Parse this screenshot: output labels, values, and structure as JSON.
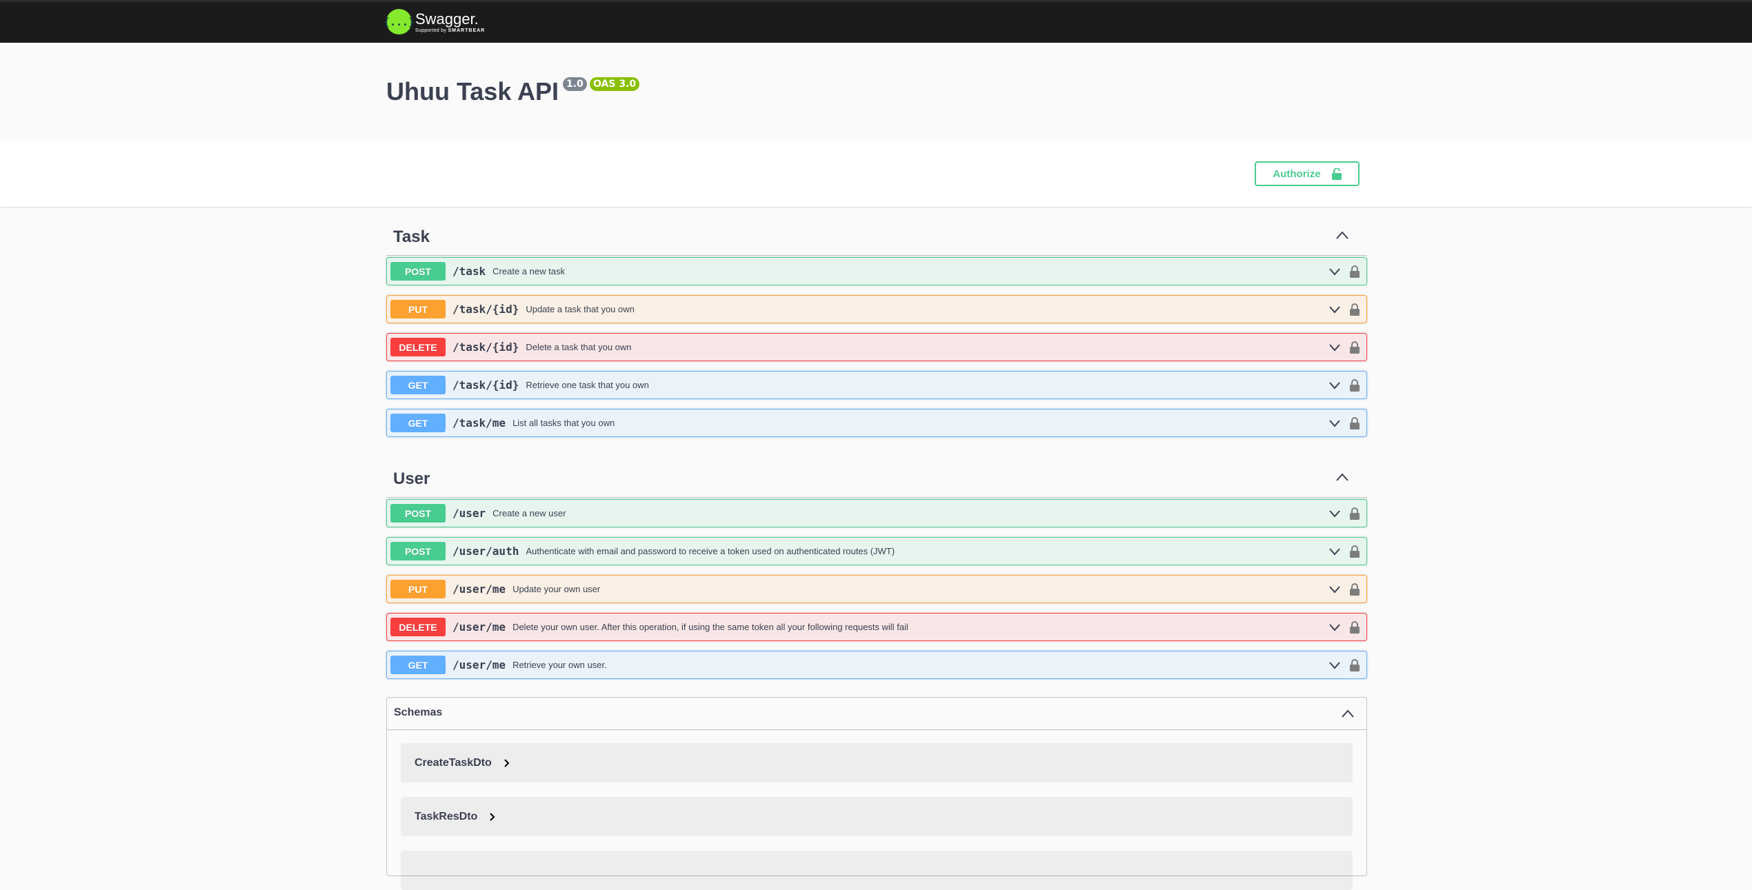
{
  "topbar": {
    "logo_mark": "{...}",
    "logo_name": "Swagger.",
    "logo_sub_prefix": "Supported by",
    "logo_sub_brand": "SMARTBEAR"
  },
  "info": {
    "title": "Uhuu Task API",
    "version": "1.0",
    "oas": "OAS 3.0"
  },
  "scheme": {
    "authorize_label": "Authorize"
  },
  "sections": [
    {
      "name": "Task",
      "operations": [
        {
          "method": "POST",
          "path": "/task",
          "summary": "Create a new task"
        },
        {
          "method": "PUT",
          "path": "/task/{id}",
          "summary": "Update a task that you own"
        },
        {
          "method": "DELETE",
          "path": "/task/{id}",
          "summary": "Delete a task that you own"
        },
        {
          "method": "GET",
          "path": "/task/{id}",
          "summary": "Retrieve one task that you own"
        },
        {
          "method": "GET",
          "path": "/task/me",
          "summary": "List all tasks that you own"
        }
      ]
    },
    {
      "name": "User",
      "operations": [
        {
          "method": "POST",
          "path": "/user",
          "summary": "Create a new user"
        },
        {
          "method": "POST",
          "path": "/user/auth",
          "summary": "Authenticate with email and password to receive a token used on authenticated routes (JWT)"
        },
        {
          "method": "PUT",
          "path": "/user/me",
          "summary": "Update your own user"
        },
        {
          "method": "DELETE",
          "path": "/user/me",
          "summary": "Delete your own user. After this operation, if using the same token all your following requests will fail"
        },
        {
          "method": "GET",
          "path": "/user/me",
          "summary": "Retrieve your own user."
        }
      ]
    }
  ],
  "schemas": {
    "title": "Schemas",
    "models": [
      "CreateTaskDto",
      "TaskResDto"
    ]
  },
  "colors": {
    "post": "#49cc90",
    "put": "#fca130",
    "delete": "#f93e3e",
    "get": "#61affe",
    "topbar": "#1b1b1b",
    "logo": "#85ea2d"
  },
  "icons": {
    "collapse": "chevron-up-icon",
    "expand": "chevron-down-icon",
    "lock": "lock-icon",
    "model_expand": "chevron-right-icon"
  }
}
